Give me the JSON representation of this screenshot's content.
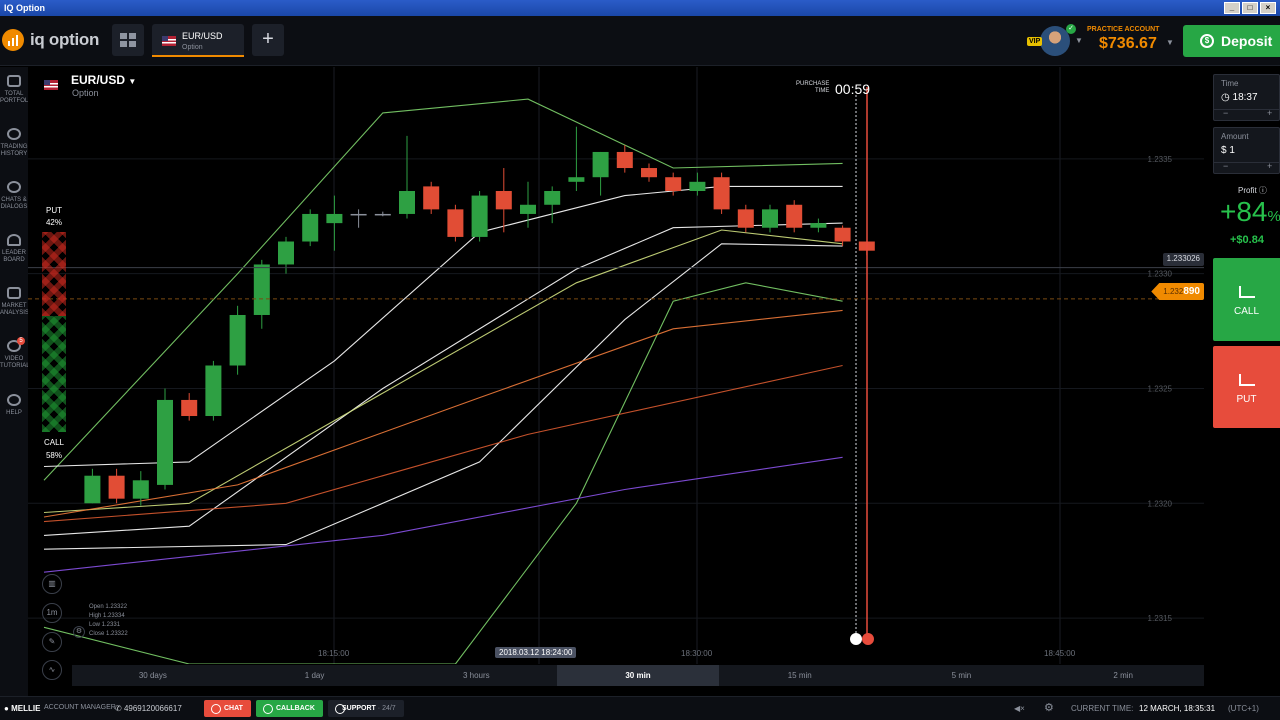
{
  "window": {
    "title": "IQ Option"
  },
  "header": {
    "logo_text": "iq option",
    "asset_tab": {
      "name": "EUR/USD",
      "sub": "Option"
    },
    "add_tab": "+",
    "vip": "VIP",
    "account_label": "PRACTICE ACCOUNT",
    "balance": "$736.67",
    "deposit": "Deposit"
  },
  "sidebar": {
    "items": [
      {
        "label1": "TOTAL",
        "label2": "PORTFOLIO",
        "icon": "briefcase-icon"
      },
      {
        "label1": "TRADING",
        "label2": "HISTORY",
        "icon": "history-icon"
      },
      {
        "label1": "CHATS &",
        "label2": "DIALOGS",
        "icon": "chat-icon"
      },
      {
        "label1": "LEADER",
        "label2": "BOARD",
        "icon": "leaderboard-icon"
      },
      {
        "label1": "MARKET",
        "label2": "ANALYSIS",
        "icon": "analysis-icon"
      },
      {
        "label1": "VIDEO",
        "label2": "TUTORIALS",
        "icon": "video-icon",
        "badge": "5"
      },
      {
        "label1": "HELP",
        "label2": "",
        "icon": "help-icon"
      }
    ]
  },
  "chart_header": {
    "asset": "EUR/USD",
    "type": "Option"
  },
  "sentiment": {
    "put_label": "PUT",
    "put_pct": "42%",
    "call_label": "CALL",
    "call_pct": "58%",
    "put_fraction": 0.42
  },
  "purchase": {
    "line1": "PURCHASE",
    "line2": "TIME",
    "countdown": "00:59"
  },
  "price_tags": {
    "current": "1.233026",
    "strike_prefix": "1.232",
    "strike_suffix": "890"
  },
  "ohlc": {
    "open": "Open  1.23322",
    "high": "High   1.23334",
    "low": "Low    1.2331",
    "close": "Close  1.23322"
  },
  "tools": {
    "timeframe": "1m"
  },
  "time_pill": "2018.03.12 18:24:00",
  "timeframes": [
    "30 days",
    "1 day",
    "3 hours",
    "30 min",
    "15 min",
    "5 min",
    "2 min"
  ],
  "active_timeframe": "30 min",
  "trade": {
    "time_label": "Time",
    "time_value": "18:37",
    "amount_label": "Amount",
    "amount_value": "$ 1",
    "profit_label": "Profit",
    "profit_pct": "+84",
    "profit_pct_sign": "%",
    "profit_amount": "+$0.84",
    "call": "CALL",
    "put": "PUT"
  },
  "statusbar": {
    "user": "MELLIE",
    "account_manager": "ACCOUNT MANAGER",
    "phone": "4969120066617",
    "chat": "CHAT",
    "callback": "CALLBACK",
    "support": "SUPPORT",
    "support_hours": "· 24/7",
    "current_time_label": "CURRENT TIME:",
    "current_time": "12 MARCH, 18:35:31",
    "timezone": "(UTC+1)"
  },
  "colors": {
    "accent": "#f08a00",
    "call": "#27a745",
    "put": "#e74c3c",
    "bg": "#000000"
  },
  "chart_data": {
    "type": "candlestick",
    "ylim": [
      1.2313,
      1.2339
    ],
    "y_ticks": [
      "1.2335",
      "1.2330",
      "1.2325",
      "1.2320",
      "1.2315"
    ],
    "x_ticks": [
      "18:15:00",
      "18:30:00",
      "18:45:00"
    ],
    "candles": [
      {
        "o": 1.23212,
        "h": 1.23215,
        "l": 1.232,
        "c": 1.232,
        "color": "green"
      },
      {
        "o": 1.23212,
        "h": 1.23215,
        "l": 1.232,
        "c": 1.23202,
        "color": "red"
      },
      {
        "o": 1.2321,
        "h": 1.23214,
        "l": 1.23199,
        "c": 1.23202,
        "color": "green"
      },
      {
        "o": 1.23208,
        "h": 1.2325,
        "l": 1.23206,
        "c": 1.23245,
        "color": "green"
      },
      {
        "o": 1.23245,
        "h": 1.23248,
        "l": 1.23236,
        "c": 1.23238,
        "color": "red"
      },
      {
        "o": 1.23238,
        "h": 1.23262,
        "l": 1.23236,
        "c": 1.2326,
        "color": "green"
      },
      {
        "o": 1.2326,
        "h": 1.23286,
        "l": 1.23256,
        "c": 1.23282,
        "color": "green"
      },
      {
        "o": 1.23282,
        "h": 1.23306,
        "l": 1.23276,
        "c": 1.23304,
        "color": "green"
      },
      {
        "o": 1.23304,
        "h": 1.23316,
        "l": 1.233,
        "c": 1.23314,
        "color": "green"
      },
      {
        "o": 1.23314,
        "h": 1.23328,
        "l": 1.23312,
        "c": 1.23326,
        "color": "green"
      },
      {
        "o": 1.23326,
        "h": 1.23334,
        "l": 1.2331,
        "c": 1.23322,
        "color": "green"
      },
      {
        "o": 1.23326,
        "h": 1.23328,
        "l": 1.2332,
        "c": 1.23326,
        "color": "doji"
      },
      {
        "o": 1.23326,
        "h": 1.23327,
        "l": 1.23325,
        "c": 1.23326,
        "color": "doji"
      },
      {
        "o": 1.23326,
        "h": 1.2336,
        "l": 1.23324,
        "c": 1.23336,
        "color": "green"
      },
      {
        "o": 1.23338,
        "h": 1.2334,
        "l": 1.23326,
        "c": 1.23328,
        "color": "red"
      },
      {
        "o": 1.23328,
        "h": 1.2333,
        "l": 1.23314,
        "c": 1.23316,
        "color": "red"
      },
      {
        "o": 1.23316,
        "h": 1.23336,
        "l": 1.23314,
        "c": 1.23334,
        "color": "green"
      },
      {
        "o": 1.23336,
        "h": 1.23346,
        "l": 1.23318,
        "c": 1.23328,
        "color": "red"
      },
      {
        "o": 1.23326,
        "h": 1.2334,
        "l": 1.2332,
        "c": 1.2333,
        "color": "green"
      },
      {
        "o": 1.2333,
        "h": 1.23338,
        "l": 1.23322,
        "c": 1.23336,
        "color": "green"
      },
      {
        "o": 1.2334,
        "h": 1.23364,
        "l": 1.23336,
        "c": 1.23342,
        "color": "green"
      },
      {
        "o": 1.23342,
        "h": 1.23353,
        "l": 1.23334,
        "c": 1.23353,
        "color": "green"
      },
      {
        "o": 1.23353,
        "h": 1.23356,
        "l": 1.23344,
        "c": 1.23346,
        "color": "red"
      },
      {
        "o": 1.23346,
        "h": 1.23348,
        "l": 1.2334,
        "c": 1.23342,
        "color": "red"
      },
      {
        "o": 1.23342,
        "h": 1.23344,
        "l": 1.23334,
        "c": 1.23336,
        "color": "red"
      },
      {
        "o": 1.23336,
        "h": 1.23344,
        "l": 1.23334,
        "c": 1.2334,
        "color": "green"
      },
      {
        "o": 1.23342,
        "h": 1.23344,
        "l": 1.23326,
        "c": 1.23328,
        "color": "red"
      },
      {
        "o": 1.23328,
        "h": 1.2333,
        "l": 1.23318,
        "c": 1.2332,
        "color": "red"
      },
      {
        "o": 1.2332,
        "h": 1.2333,
        "l": 1.23318,
        "c": 1.23328,
        "color": "green"
      },
      {
        "o": 1.2333,
        "h": 1.23332,
        "l": 1.23318,
        "c": 1.2332,
        "color": "red"
      },
      {
        "o": 1.23322,
        "h": 1.23324,
        "l": 1.23318,
        "c": 1.2332,
        "color": "green"
      },
      {
        "o": 1.2332,
        "h": 1.23321,
        "l": 1.23312,
        "c": 1.23314,
        "color": "red"
      },
      {
        "o": 1.23314,
        "h": 1.23314,
        "l": 1.23308,
        "c": 1.2331,
        "color": "red"
      }
    ],
    "candle_start": 2.0,
    "candle_step": 1.0,
    "series": [
      {
        "color": "#7dd36b",
        "values": [
          [
            0,
            1.2321
          ],
          [
            8,
            1.233
          ],
          [
            14,
            1.2337
          ],
          [
            20,
            1.23376
          ],
          [
            26,
            1.23346
          ],
          [
            33,
            1.23348
          ]
        ]
      },
      {
        "color": "#7dd36b",
        "values": [
          [
            0,
            1.23146
          ],
          [
            6,
            1.2313
          ],
          [
            17,
            1.2313
          ],
          [
            22,
            1.232
          ],
          [
            26,
            1.23288
          ],
          [
            29,
            1.23296
          ],
          [
            33,
            1.23288
          ]
        ]
      },
      {
        "color": "#ffffff",
        "values": [
          [
            0,
            1.23216
          ],
          [
            6,
            1.23218
          ],
          [
            12,
            1.23262
          ],
          [
            18,
            1.23318
          ],
          [
            24,
            1.23334
          ],
          [
            28,
            1.23338
          ],
          [
            33,
            1.23338
          ]
        ]
      },
      {
        "color": "#ffffff",
        "values": [
          [
            0,
            1.23186
          ],
          [
            6,
            1.2319
          ],
          [
            14,
            1.2325
          ],
          [
            22,
            1.23302
          ],
          [
            26,
            1.2332
          ],
          [
            33,
            1.23322
          ]
        ]
      },
      {
        "color": "#ffffff",
        "values": [
          [
            0,
            1.2318
          ],
          [
            10,
            1.23182
          ],
          [
            18,
            1.23218
          ],
          [
            24,
            1.2328
          ],
          [
            28,
            1.23313
          ],
          [
            33,
            1.23312
          ]
        ]
      },
      {
        "color": "#d0e080",
        "values": [
          [
            0,
            1.23196
          ],
          [
            6,
            1.232
          ],
          [
            14,
            1.23248
          ],
          [
            22,
            1.23296
          ],
          [
            28,
            1.23319
          ],
          [
            33,
            1.23313
          ]
        ]
      },
      {
        "color": "#ee7a3a",
        "values": [
          [
            0,
            1.23194
          ],
          [
            8,
            1.23208
          ],
          [
            18,
            1.23246
          ],
          [
            26,
            1.23276
          ],
          [
            33,
            1.23284
          ]
        ]
      },
      {
        "color": "#d95a30",
        "values": [
          [
            0,
            1.23192
          ],
          [
            10,
            1.232
          ],
          [
            20,
            1.2323
          ],
          [
            33,
            1.2326
          ]
        ]
      },
      {
        "color": "#8a52e8",
        "values": [
          [
            0,
            1.2317
          ],
          [
            14,
            1.23186
          ],
          [
            24,
            1.23206
          ],
          [
            33,
            1.2322
          ]
        ]
      }
    ]
  }
}
